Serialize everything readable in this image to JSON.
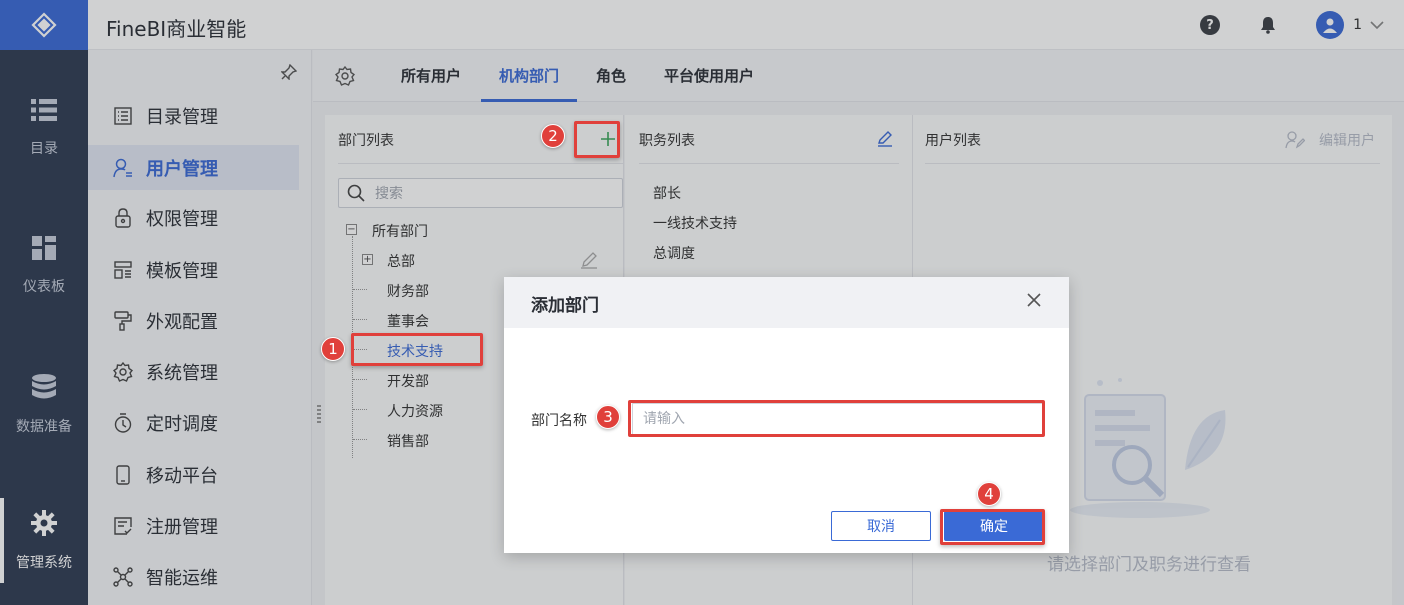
{
  "app": {
    "title": "FineBI商业智能"
  },
  "header": {
    "user_name": "1"
  },
  "leftnav": {
    "items": [
      {
        "label": "目录",
        "icon": "list-icon"
      },
      {
        "label": "仪表板",
        "icon": "dashboard-icon"
      },
      {
        "label": "数据准备",
        "icon": "database-icon"
      },
      {
        "label": "管理系统",
        "icon": "gear-icon",
        "active": true
      }
    ]
  },
  "sidebar": {
    "items": [
      {
        "label": "目录管理",
        "icon": "catalog-icon"
      },
      {
        "label": "用户管理",
        "icon": "user-icon",
        "active": true
      },
      {
        "label": "权限管理",
        "icon": "lock-icon"
      },
      {
        "label": "模板管理",
        "icon": "template-icon"
      },
      {
        "label": "外观配置",
        "icon": "paint-roller-icon"
      },
      {
        "label": "系统管理",
        "icon": "settings-icon"
      },
      {
        "label": "定时调度",
        "icon": "timer-icon"
      },
      {
        "label": "移动平台",
        "icon": "mobile-icon"
      },
      {
        "label": "注册管理",
        "icon": "register-icon"
      },
      {
        "label": "智能运维",
        "icon": "network-icon"
      }
    ]
  },
  "tabs": [
    "所有用户",
    "机构部门",
    "角色",
    "平台使用用户"
  ],
  "dept_panel": {
    "title": "部门列表",
    "search_placeholder": "搜索",
    "root": "所有部门",
    "nodes": [
      "总部",
      "财务部",
      "董事会",
      "技术支持",
      "开发部",
      "人力资源",
      "销售部"
    ],
    "selected": "技术支持"
  },
  "duty_panel": {
    "title": "职务列表",
    "items": [
      "部长",
      "一线技术支持",
      "总调度"
    ]
  },
  "user_panel": {
    "title": "用户列表",
    "edit_label": "编辑用户",
    "empty_text": "请选择部门及职务进行查看"
  },
  "dialog": {
    "title": "添加部门",
    "field_label": "部门名称",
    "input_placeholder": "请输入",
    "input_value": "",
    "cancel_label": "取消",
    "ok_label": "确定"
  },
  "annotations": [
    "1",
    "2",
    "3",
    "4"
  ],
  "colors": {
    "accent": "#3a6ad6",
    "nav_bg": "#2f3b52",
    "highlight": "#e0403b",
    "add_green": "#3aa55b"
  }
}
